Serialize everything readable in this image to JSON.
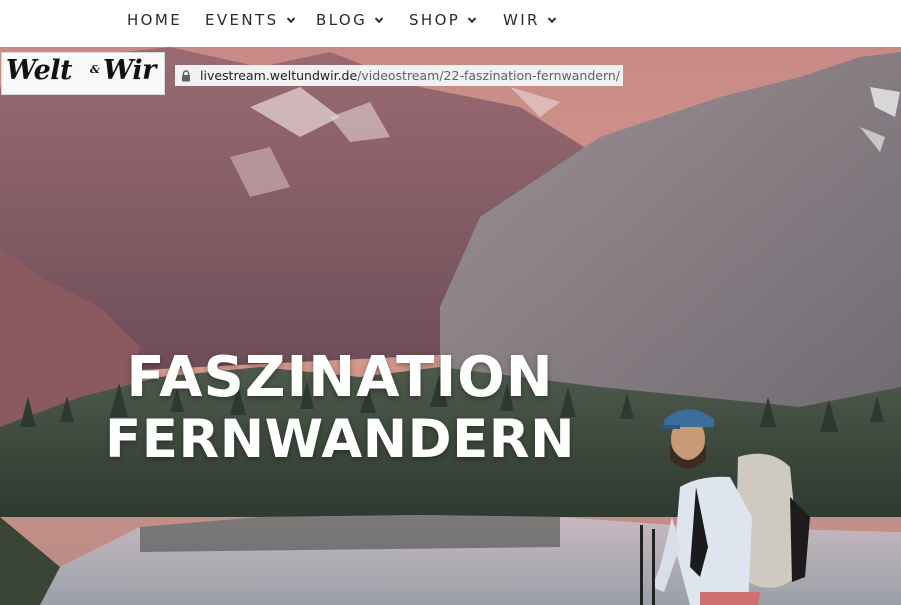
{
  "nav": {
    "items": [
      {
        "label": "HOME",
        "has_dropdown": false
      },
      {
        "label": "EVENTS",
        "has_dropdown": true
      },
      {
        "label": "BLOG",
        "has_dropdown": true
      },
      {
        "label": "SHOP",
        "has_dropdown": true
      },
      {
        "label": "WIR",
        "has_dropdown": true
      }
    ]
  },
  "logo": {
    "word1": "Welt",
    "amp": "&",
    "word2": "Wir"
  },
  "urlbar": {
    "host": "livestream.weltundwir.de",
    "path": "/videostream/22-faszination-fernwandern/",
    "icon": "lock-icon"
  },
  "hero": {
    "title_line1": "FASZINATION",
    "title_line2": "FERNWANDERN"
  },
  "colors": {
    "nav_text": "#2b2b2b",
    "title_text": "#ffffff",
    "urlbar_bg": "#f1f1f1"
  }
}
